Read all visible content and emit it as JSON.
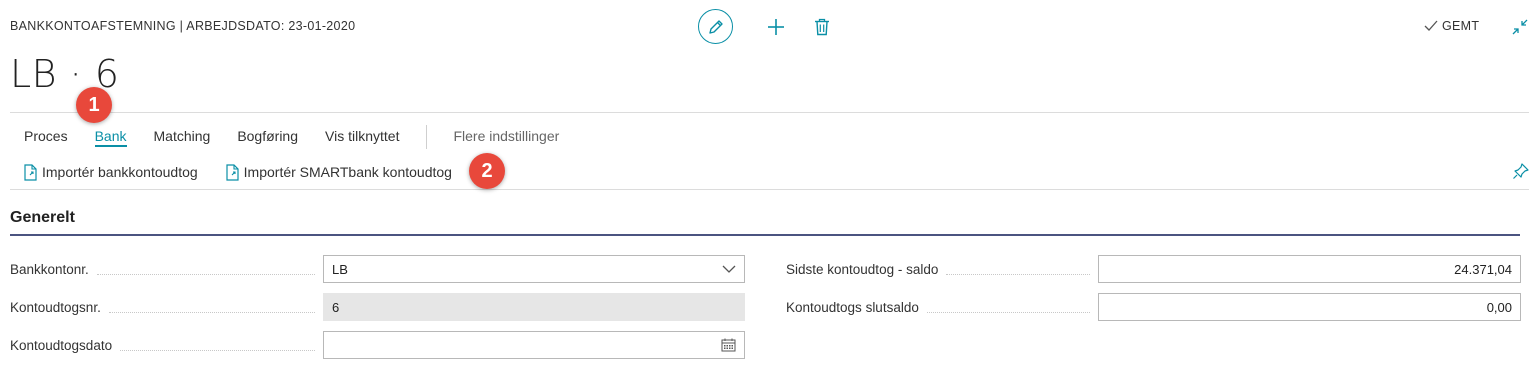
{
  "header": {
    "caption": "BANKKONTOAFSTEMNING | ARBEJDSDATO: 23-01-2020",
    "title": "LB · 6",
    "saved_label": "GEMT"
  },
  "tabs": [
    {
      "label": "Proces",
      "active": false
    },
    {
      "label": "Bank",
      "active": true
    },
    {
      "label": "Matching",
      "active": false
    },
    {
      "label": "Bogføring",
      "active": false
    },
    {
      "label": "Vis tilknyttet",
      "active": false
    }
  ],
  "more_settings": "Flere indstillinger",
  "actions": [
    {
      "label": "Importér bankkontoudtog",
      "icon": "document-import-icon"
    },
    {
      "label": "Importér SMARTbank kontoudtog",
      "icon": "document-import-icon"
    }
  ],
  "section": {
    "title": "Generelt"
  },
  "fields_left": [
    {
      "label": "Bankkontonr.",
      "value": "LB",
      "type": "select"
    },
    {
      "label": "Kontoudtogsnr.",
      "value": "6",
      "type": "readonly"
    },
    {
      "label": "Kontoudtogsdato",
      "value": "",
      "type": "date"
    }
  ],
  "fields_right": [
    {
      "label": "Sidste kontoudtog - saldo",
      "value": "24.371,04",
      "type": "number"
    },
    {
      "label": "Kontoudtogs slutsaldo",
      "value": "0,00",
      "type": "number"
    }
  ],
  "badges": {
    "first": "1",
    "second": "2"
  },
  "colors": {
    "accent": "#0a8fa6",
    "badge": "#e8483b",
    "section_line": "#4b5480"
  }
}
